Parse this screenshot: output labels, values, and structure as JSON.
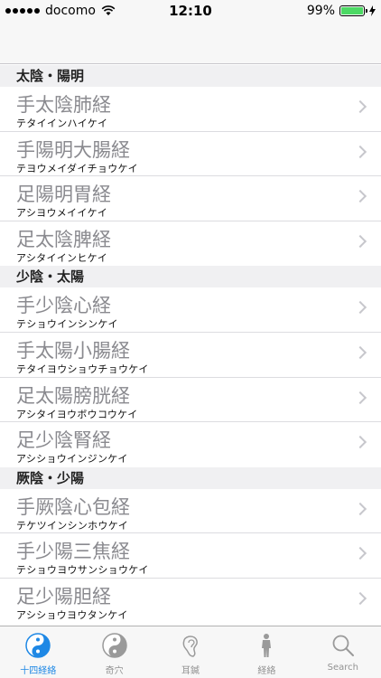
{
  "status": {
    "carrier": "docomo",
    "time": "12:10",
    "battery": "99%",
    "battery_level": 0.99
  },
  "colors": {
    "accent": "#1e88e5",
    "battery": "#4cd964"
  },
  "sections": [
    {
      "header": "太陰・陽明",
      "rows": [
        {
          "title": "手太陰肺経",
          "subtitle": "テタイインハイケイ"
        },
        {
          "title": "手陽明大腸経",
          "subtitle": "テヨウメイダイチョウケイ"
        },
        {
          "title": "足陽明胃経",
          "subtitle": "アシヨウメイイケイ"
        },
        {
          "title": "足太陰脾経",
          "subtitle": "アシタイインヒケイ"
        }
      ]
    },
    {
      "header": "少陰・太陽",
      "rows": [
        {
          "title": "手少陰心経",
          "subtitle": "テショウインシンケイ"
        },
        {
          "title": "手太陽小腸経",
          "subtitle": "テタイヨウショウチョウケイ"
        },
        {
          "title": "足太陽膀胱経",
          "subtitle": "アシタイヨウボウコウケイ"
        },
        {
          "title": "足少陰腎経",
          "subtitle": "アシショウインジンケイ"
        }
      ]
    },
    {
      "header": "厥陰・少陽",
      "rows": [
        {
          "title": "手厥陰心包経",
          "subtitle": "テケツインシンホウケイ"
        },
        {
          "title": "手少陽三焦経",
          "subtitle": "テショウヨウサンショウケイ"
        },
        {
          "title": "足少陽胆経",
          "subtitle": "アシショウヨウタンケイ"
        }
      ]
    }
  ],
  "tabs": [
    {
      "label": "十四経絡",
      "icon": "yin-yang-blue-icon",
      "active": true
    },
    {
      "label": "奇穴",
      "icon": "yin-yang-gray-icon",
      "active": false
    },
    {
      "label": "耳鍼",
      "icon": "ear-icon",
      "active": false
    },
    {
      "label": "経絡",
      "icon": "human-figure-icon",
      "active": false
    },
    {
      "label": "Search",
      "icon": "search-icon",
      "active": false
    }
  ]
}
